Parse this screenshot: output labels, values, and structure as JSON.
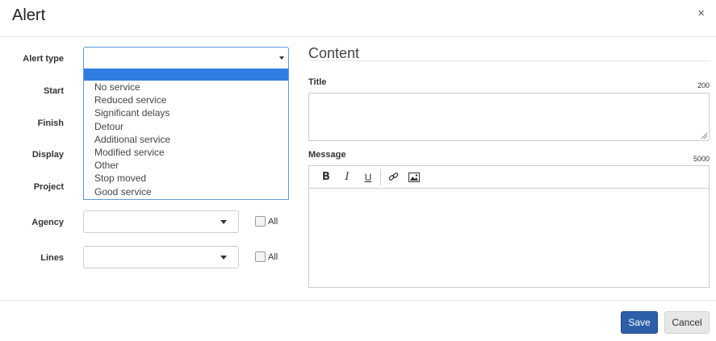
{
  "header": {
    "title": "Alert",
    "close_glyph": "×"
  },
  "form": {
    "alert_type_label": "Alert type",
    "alert_type_value": "",
    "start_label": "Start",
    "finish_label": "Finish",
    "display_label": "Display",
    "project_label": "Project",
    "agency_label": "Agency",
    "agency_value": "",
    "agency_all_label": "All",
    "lines_label": "Lines",
    "lines_value": "",
    "lines_all_label": "All"
  },
  "alert_type_options": [
    "No service",
    "Reduced service",
    "Significant delays",
    "Detour",
    "Additional service",
    "Modified service",
    "Other",
    "Stop moved",
    "Good service"
  ],
  "content": {
    "heading": "Content",
    "title_label": "Title",
    "title_limit": "200",
    "message_label": "Message",
    "message_limit": "5000",
    "toolbar_icons": [
      "bold-icon",
      "italic-icon",
      "underline-icon",
      "link-icon",
      "image-icon"
    ]
  },
  "footer": {
    "save_label": "Save",
    "cancel_label": "Cancel"
  },
  "colors": {
    "accent": "#2d5fa8",
    "dropdown_highlight": "#2f7de1",
    "focus_border": "#5b9bd5"
  }
}
